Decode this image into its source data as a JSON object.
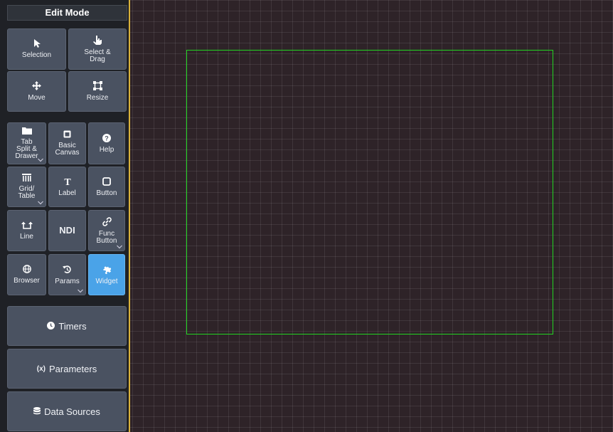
{
  "sidebar": {
    "title": "Edit Mode",
    "tools": {
      "selection": "Selection",
      "select_drag": "Select &\nDrag",
      "move": "Move",
      "resize": "Resize",
      "tab_split_drawer": "Tab\nSplit &\nDrawer",
      "basic_canvas": "Basic\nCanvas",
      "help": "Help",
      "grid_table": "Grid/\nTable",
      "label": "Label",
      "button": "Button",
      "line": "Line",
      "ndi": "NDI",
      "func_button": "Func\nButton",
      "browser": "Browser",
      "params": "Params",
      "widget": "Widget"
    },
    "active_tool": "Widget",
    "panels": {
      "timers": "Timers",
      "parameters": "Parameters",
      "parameters_icon_text": "(x)",
      "data_sources": "Data Sources"
    }
  },
  "colors": {
    "sidebar_bg": "#1f2126",
    "tool_bg": "#4a5261",
    "active_tool": "#4aa3e8",
    "divider": "#d9b23a",
    "canvas_bg": "#2e2328",
    "frame_border": "#21d321"
  },
  "icons": {
    "selection": "cursor-arrow-icon",
    "select_drag": "hand-pointer-icon",
    "move": "move-arrows-icon",
    "resize": "resize-frame-icon",
    "tab_split_drawer": "folder-tab-icon",
    "basic_canvas": "canvas-square-icon",
    "help": "question-circle-icon",
    "grid_table": "table-icon",
    "label": "text-t-icon",
    "button": "rounded-square-icon",
    "line": "line-arrows-icon",
    "func_button": "link-icon",
    "browser": "globe-icon",
    "params": "refresh-icon",
    "widget": "puzzle-icon",
    "timers": "clock-icon",
    "data_sources": "database-icon"
  }
}
